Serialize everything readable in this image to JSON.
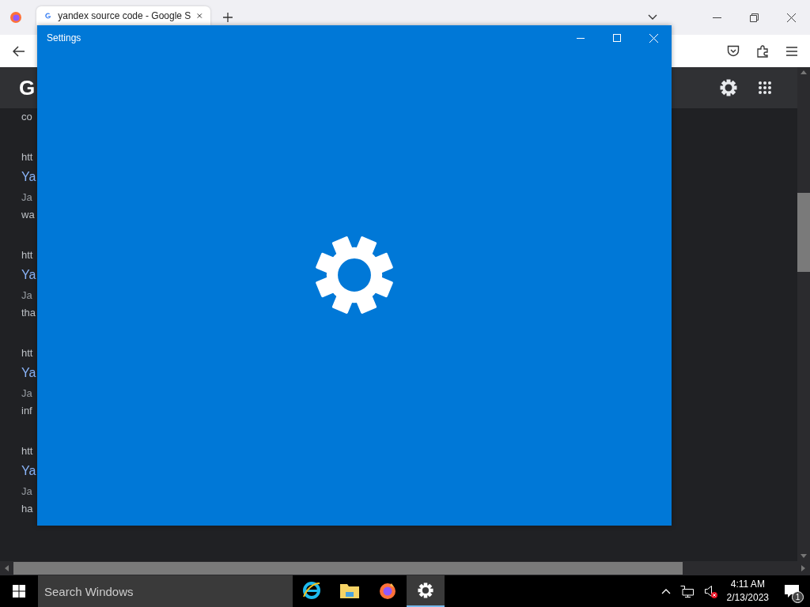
{
  "browser": {
    "tabs": [
      {
        "title": "yandex source code - Google S",
        "selected": true
      }
    ],
    "header": {
      "logo": "G"
    },
    "top_fragment": "co",
    "results": [
      {
        "url": "htt",
        "title": "Ya",
        "date": "Ja",
        "snippet": "wa"
      },
      {
        "url": "htt",
        "title": "Ya",
        "date": "Ja",
        "snippet": "tha"
      },
      {
        "url": "htt",
        "title": "Ya",
        "date": "Ja",
        "snippet": "inf"
      },
      {
        "url": "htt",
        "title": "Ya",
        "date": "Ja",
        "snippet": "ha"
      }
    ]
  },
  "settings_window": {
    "title": "Settings"
  },
  "taskbar": {
    "search": {
      "placeholder": "Search Windows"
    },
    "apps": [
      {
        "kind": "ie",
        "selected": false
      },
      {
        "kind": "folder",
        "selected": false
      },
      {
        "kind": "firefox",
        "selected": false
      },
      {
        "kind": "settings",
        "selected": true
      }
    ],
    "tray": {
      "muted": true,
      "time": "4:11 AM",
      "date": "2/13/2023",
      "notifications": "1"
    }
  }
}
